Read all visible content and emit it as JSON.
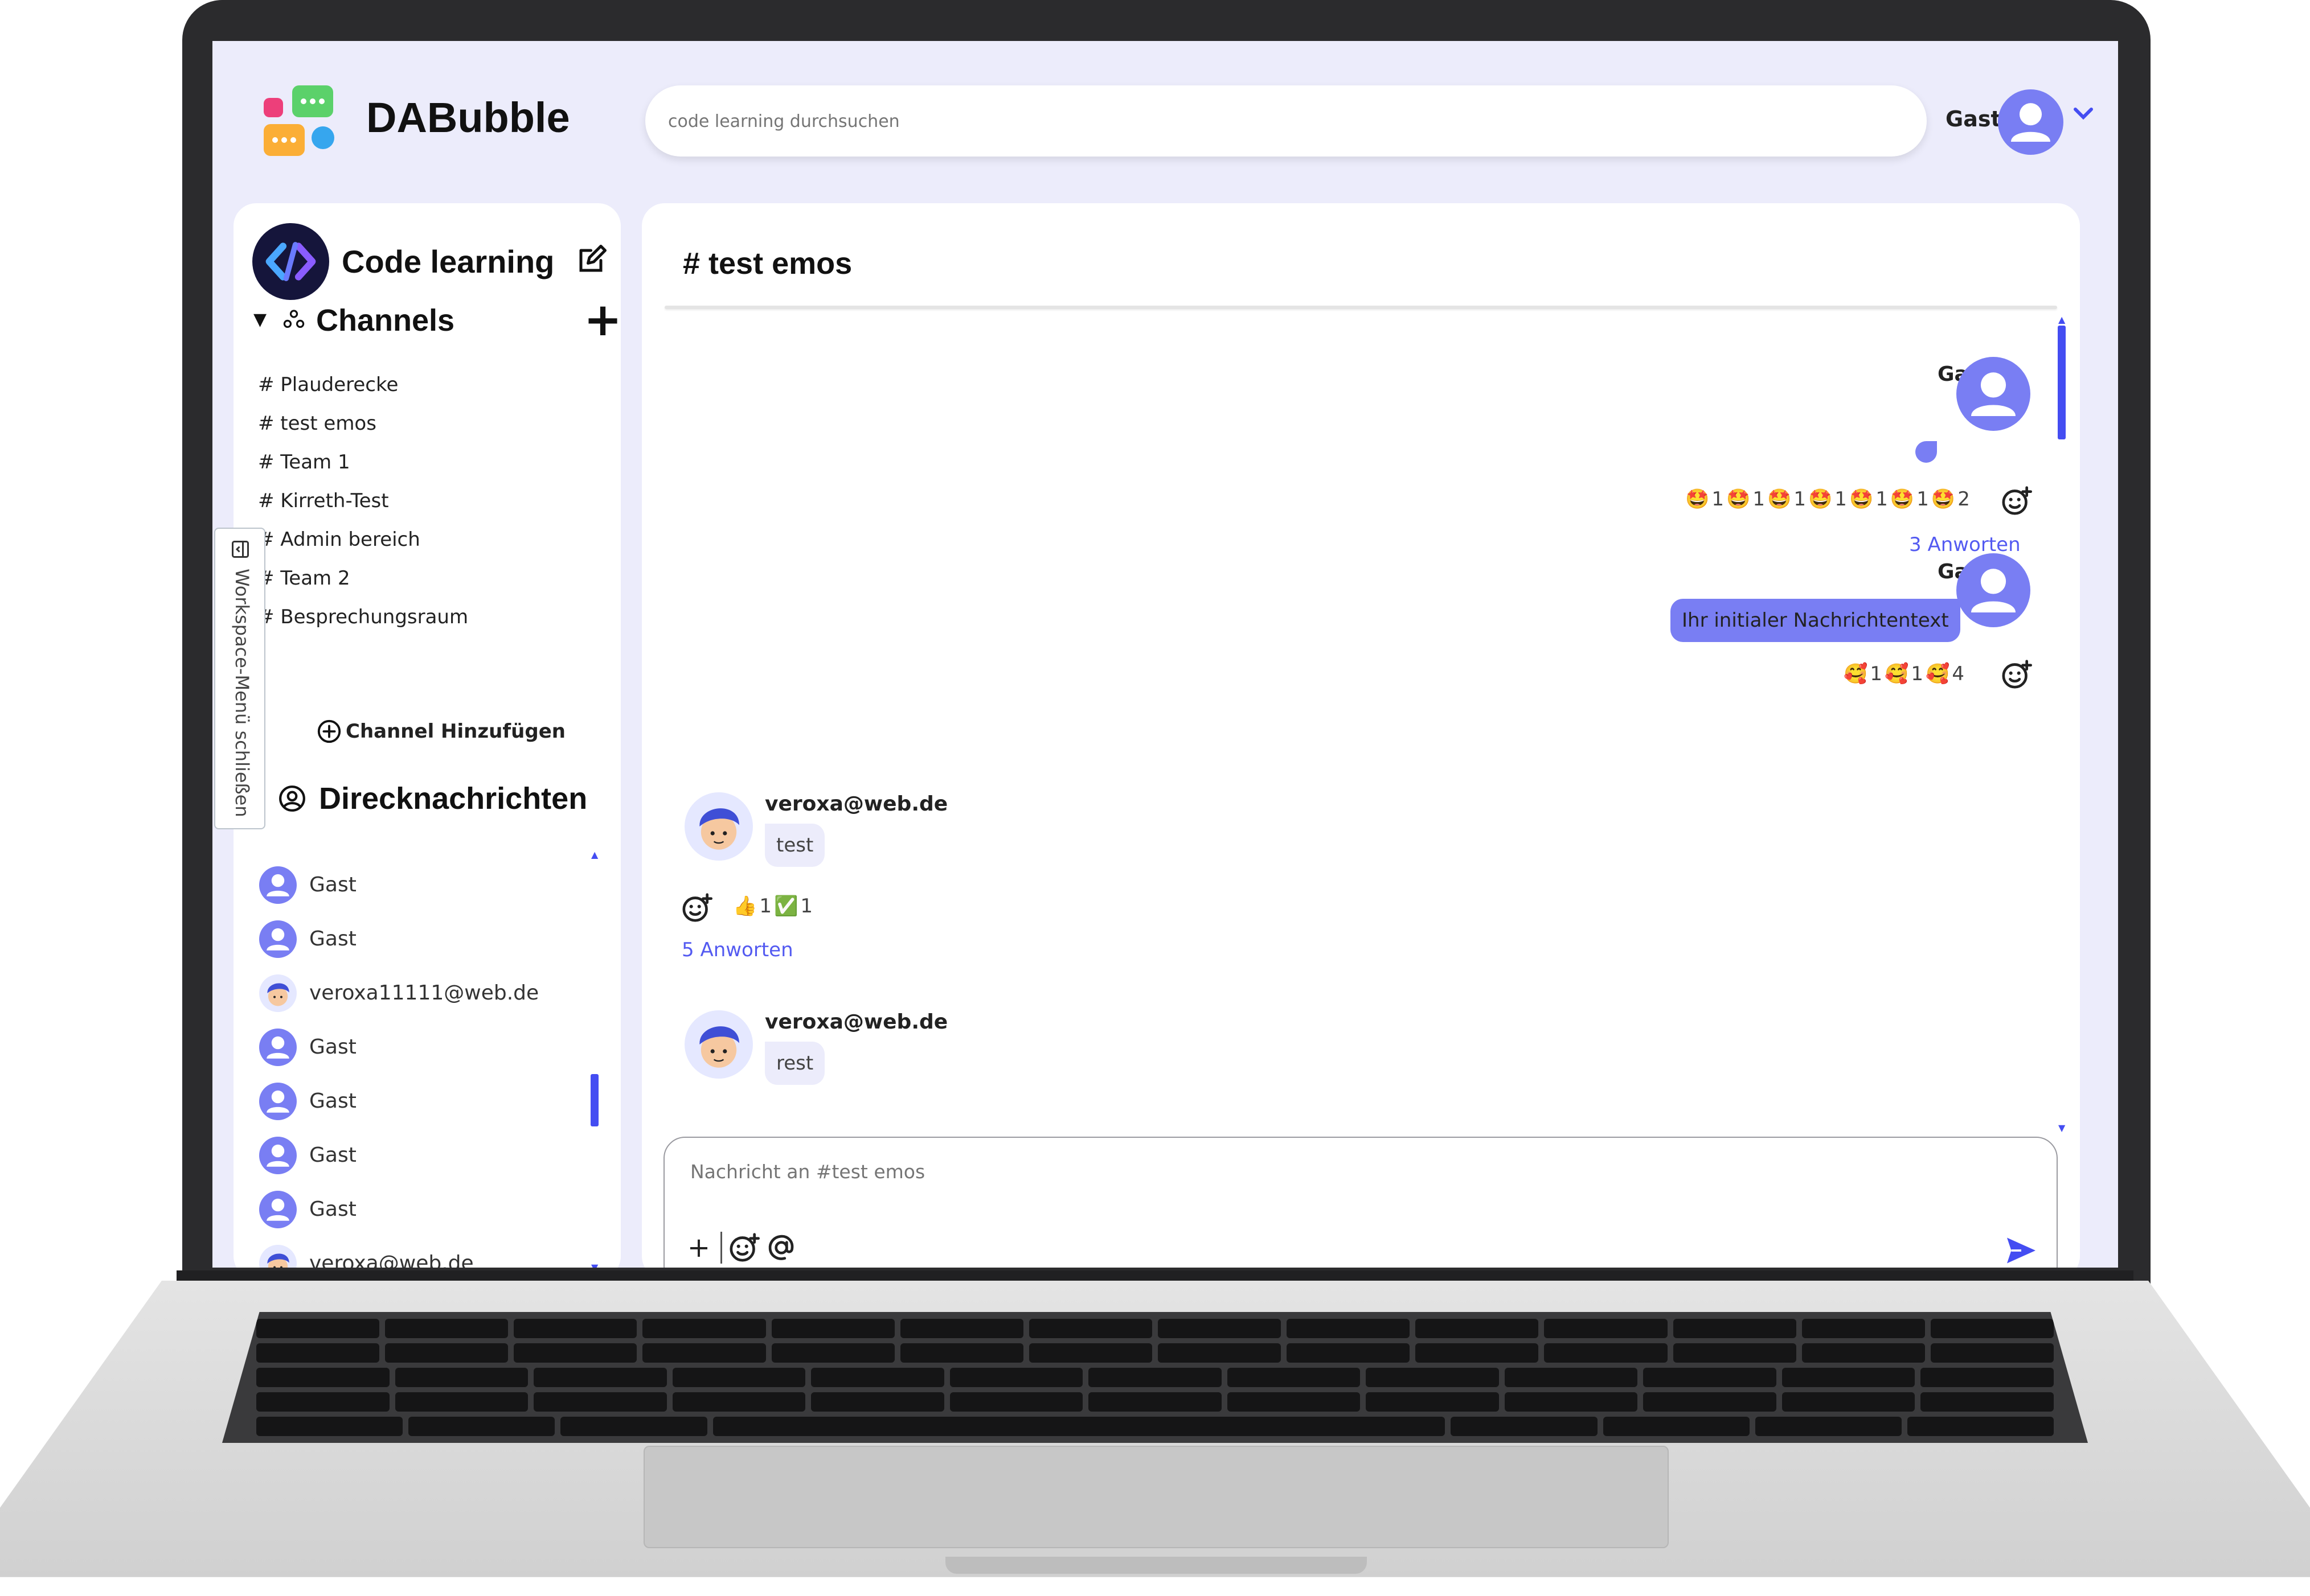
{
  "app": {
    "name": "DABubble",
    "search_placeholder": "code learning durchsuchen",
    "user_name": "Gast"
  },
  "sidebar": {
    "workspace_name": "Code learning",
    "channels_label": "Channels",
    "channels": [
      "# Plauderecke",
      "# test emos",
      "# Team 1",
      "# Kirreth-Test",
      "# Admin bereich",
      "# Team 2",
      "# Besprechungsraum"
    ],
    "add_channel_label": "Channel Hinzufügen",
    "dm_label": "Direcknachrichten",
    "direct_messages": [
      {
        "name": "Gast",
        "avatar": "default"
      },
      {
        "name": "Gast",
        "avatar": "default"
      },
      {
        "name": "veroxa11111@web.de",
        "avatar": "photo"
      },
      {
        "name": "Gast",
        "avatar": "default"
      },
      {
        "name": "Gast",
        "avatar": "default"
      },
      {
        "name": "Gast",
        "avatar": "default"
      },
      {
        "name": "Gast",
        "avatar": "default"
      },
      {
        "name": "veroxa@web.de",
        "avatar": "photo"
      }
    ],
    "workspace_toggle_label": "Workspace-Menü schließen"
  },
  "channel": {
    "title": "# test emos",
    "messages": [
      {
        "author": "Gast",
        "mine": true,
        "text": "",
        "reactions": [
          {
            "emoji": "🤩",
            "count": "1"
          },
          {
            "emoji": "🤩",
            "count": "1"
          },
          {
            "emoji": "🤩",
            "count": "1"
          },
          {
            "emoji": "🤩",
            "count": "1"
          },
          {
            "emoji": "🤩",
            "count": "1"
          },
          {
            "emoji": "🤩",
            "count": "1"
          },
          {
            "emoji": "🤩",
            "count": "2"
          }
        ],
        "replies": "3 Anworten"
      },
      {
        "author": "Gast",
        "mine": true,
        "text": "Ihr initialer Nachrichtentext",
        "reactions": [
          {
            "emoji": "🥰",
            "count": "1"
          },
          {
            "emoji": "🥰",
            "count": "1"
          },
          {
            "emoji": "🥰",
            "count": "4"
          }
        ],
        "replies": ""
      },
      {
        "author": "veroxa@web.de",
        "mine": false,
        "text": "test",
        "reactions": [
          {
            "emoji": "👍",
            "count": "1"
          },
          {
            "emoji": "✅",
            "count": "1"
          }
        ],
        "replies": "5 Anworten"
      },
      {
        "author": "veroxa@web.de",
        "mine": false,
        "text": "rest",
        "reactions": [],
        "replies": ""
      }
    ],
    "composer_placeholder": "Nachricht an #test emos"
  },
  "colors": {
    "accent": "#444df2",
    "bubble_mine": "#797ef3",
    "background": "#ececfb",
    "reply_link": "#535af1"
  },
  "icons": [
    "logo-icon",
    "edit-icon",
    "caret-down-icon",
    "channels-icon",
    "plus-icon",
    "add-circle-icon",
    "account-circle-icon",
    "default-avatar-icon",
    "photo-avatar-icon",
    "add-reaction-icon",
    "at-icon",
    "send-icon",
    "sidebar-toggle-icon",
    "chevron-down-icon"
  ]
}
